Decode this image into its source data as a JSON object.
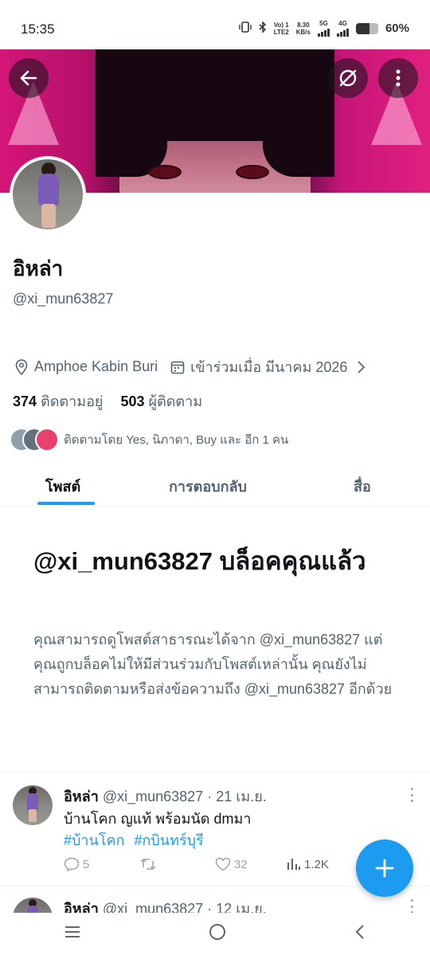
{
  "status_bar": {
    "time": "15:35",
    "volte_line1": "Vo) 1",
    "volte_line2": "LTE2",
    "speed_line1": "8.30",
    "speed_line2": "KB/s",
    "net1": "5G",
    "net2": "4G",
    "battery": "60%",
    "battery_level": 0.6
  },
  "profile": {
    "name": "อิหล่า",
    "handle": "@xi_mun63827",
    "location": "Amphoe Kabin Buri",
    "joined": "เข้าร่วมเมื่อ มีนาคม 2026",
    "following_count": "374",
    "following_label": "ติดตามอยู่",
    "followers_count": "503",
    "followers_label": "ผู้ติดตาม",
    "followed_by": "ติดตามโดย Yes, นิภาดา, Buy และ อีก 1 คน"
  },
  "tabs": [
    {
      "label": "โพสต์",
      "active": true
    },
    {
      "label": "การตอบกลับ",
      "active": false
    },
    {
      "label": "สื่อ",
      "active": false
    }
  ],
  "blocked": {
    "title": "@xi_mun63827 บล็อคคุณแล้ว",
    "body": "คุณสามารถดูโพสต์สาธารณะได้จาก @xi_mun63827 แต่คุณถูกบล็อคไม่ให้มีส่วนร่วมกับโพสต์เหล่านั้น คุณยังไม่สามารถติดตามหรือส่งข้อความถึง @xi_mun63827 อีกด้วย"
  },
  "posts": [
    {
      "name": "อิหล่า",
      "meta": "@xi_mun63827 · 21 เม.ย.",
      "text": "บ้านโคก  ญแท้ พร้อมนัด  dmมา",
      "tags": [
        "#บ้านโคก",
        "#กบินทร์บุรี"
      ],
      "replies": "5",
      "reposts": "",
      "likes": "32",
      "views": "1.2K"
    },
    {
      "name": "อิหล่า",
      "meta": "@xi_mun63827 · 12 เม.ย."
    }
  ],
  "colors": {
    "accent": "#1d9bf0",
    "text_primary": "#0f1419",
    "text_secondary": "#536471"
  }
}
